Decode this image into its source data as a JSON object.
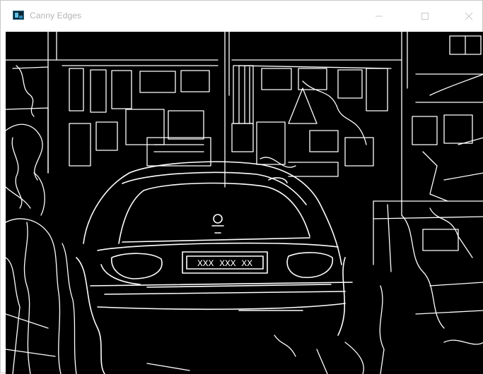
{
  "window": {
    "title": "Canny Edges",
    "icon": "opencv-window-icon",
    "controls": [
      "minimize-icon",
      "maximize-icon",
      "close-icon"
    ]
  },
  "image": {
    "description_kind": "canny-edge-output",
    "background_color": "#000000",
    "edge_color": "#ffffff",
    "plate_text": "XXX XXX XX"
  }
}
